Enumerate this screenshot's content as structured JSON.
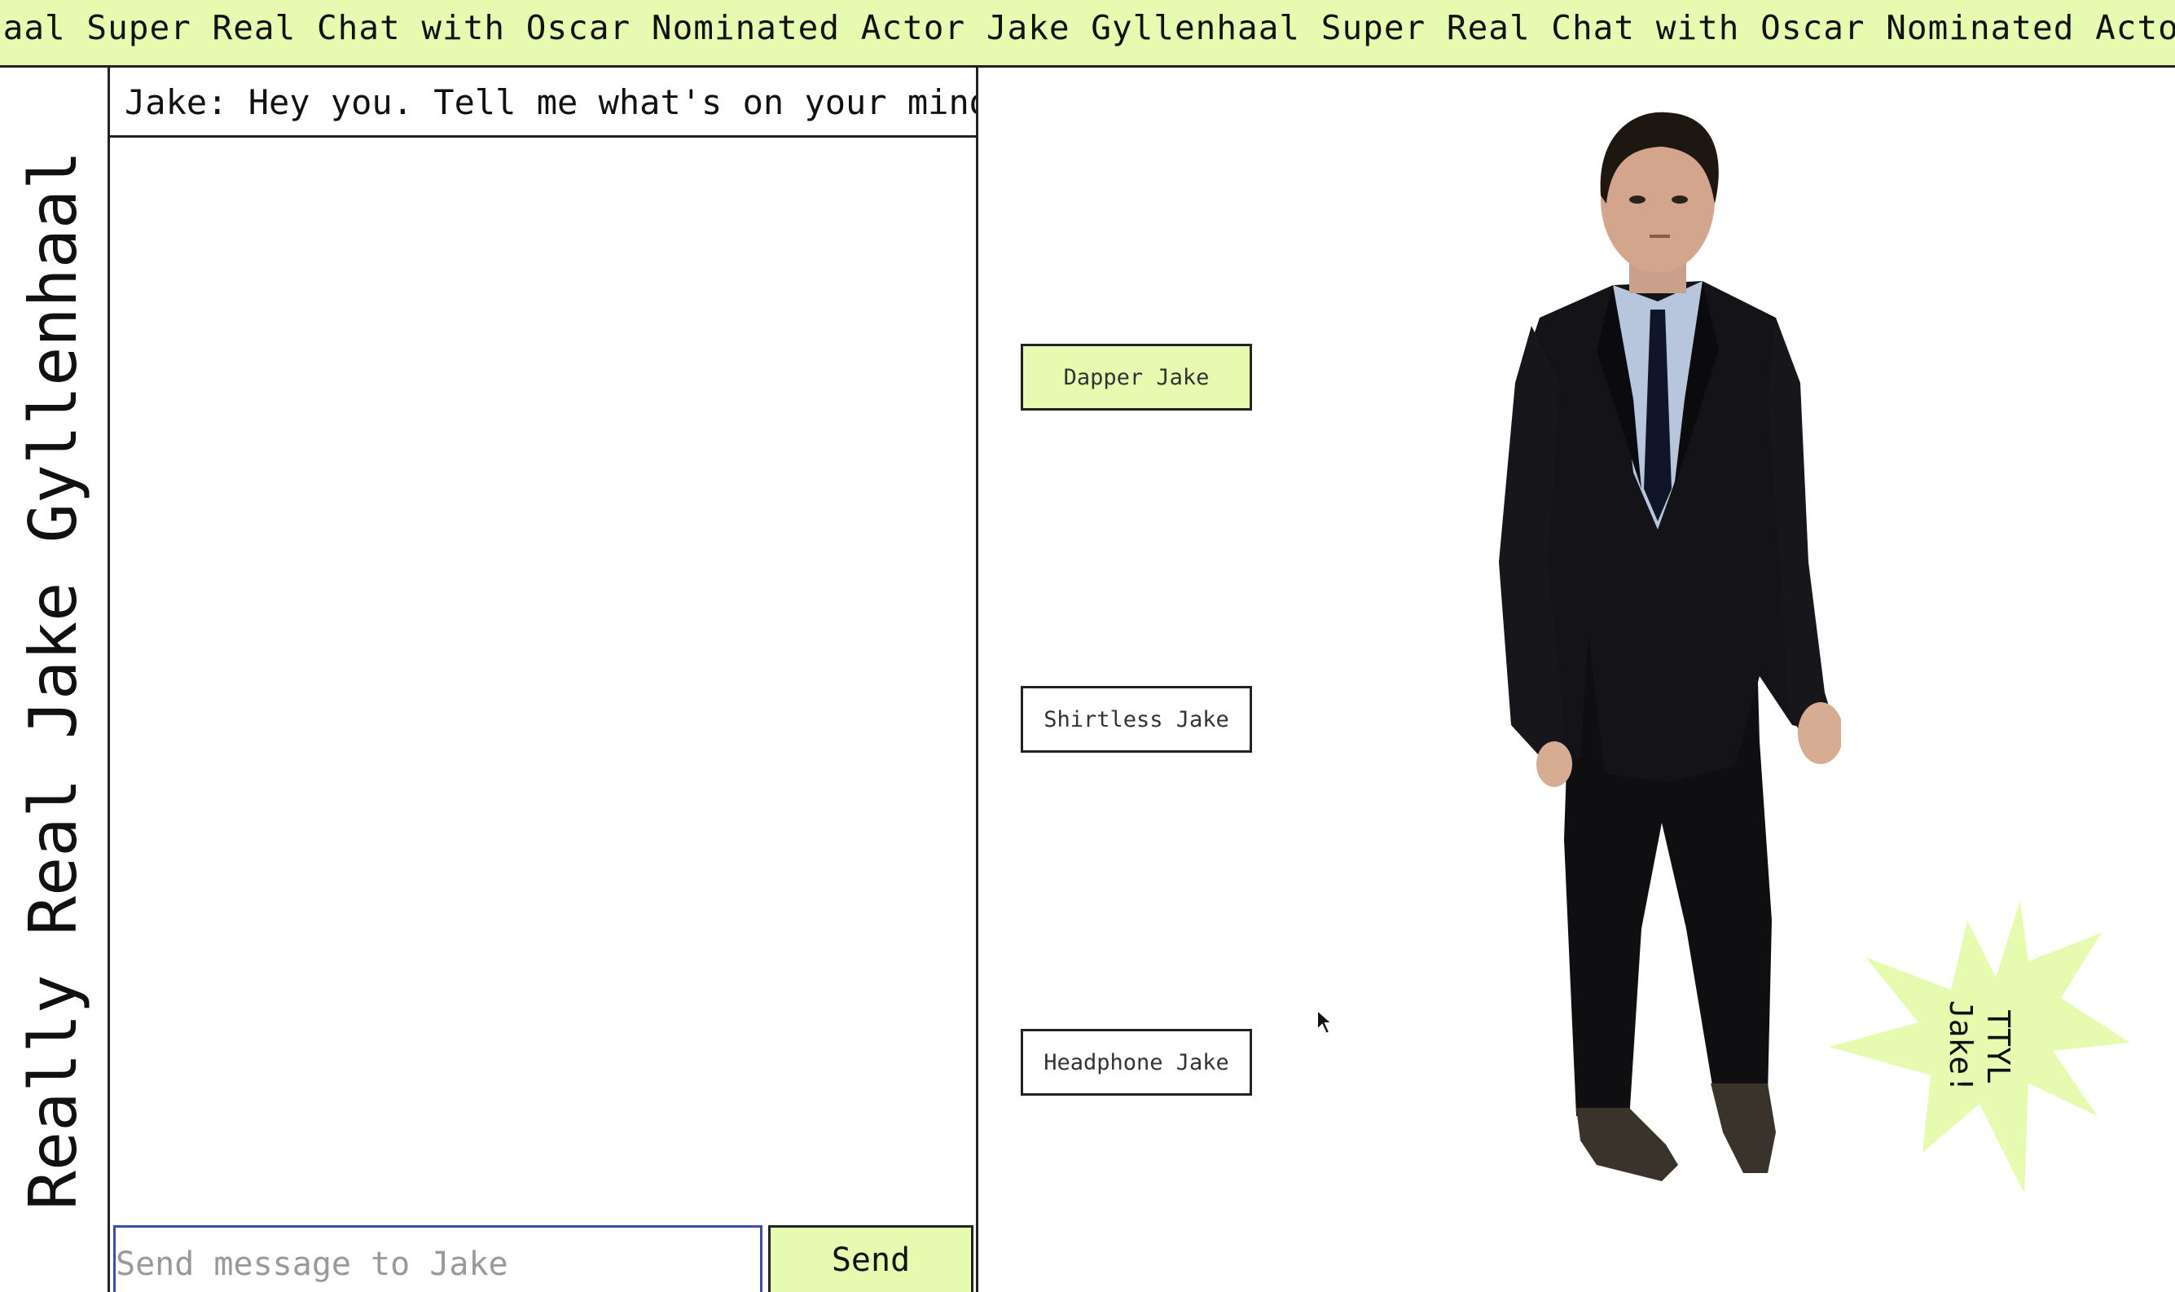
{
  "marquee": {
    "text": "haal Super Real Chat with Oscar Nominated Actor Jake Gyllenhaal Super Real Chat with Oscar Nominated Actor Jake Gyllenhaal Super Real"
  },
  "sidebar": {
    "title": "Really Real Jake Gyllenhaal"
  },
  "chat": {
    "messages": [
      {
        "text": "Jake: Hey you. Tell me what's on your mind."
      }
    ],
    "input_placeholder": "Send message to Jake",
    "send_label": "Send"
  },
  "skins": [
    {
      "label": "Dapper Jake",
      "active": true
    },
    {
      "label": "Shirtless Jake",
      "active": false
    },
    {
      "label": "Headphone Jake",
      "active": false
    }
  ],
  "starburst": {
    "label": "TTYL\nJake!"
  },
  "colors": {
    "accent": "#e6fbb0",
    "border": "#222222",
    "input_focus": "#3b4fa8"
  }
}
